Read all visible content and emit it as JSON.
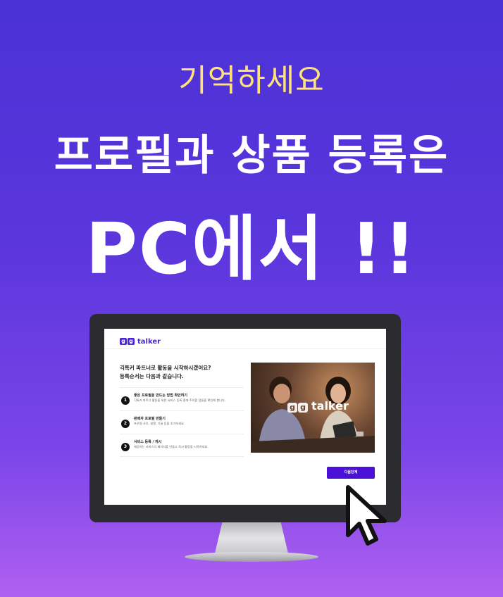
{
  "headline": {
    "kicker": "기억하세요",
    "sub": "프로필과 상품 등록은",
    "main": "PC에서 !!"
  },
  "colors": {
    "kicker": "#ffe27a",
    "accent": "#4a22d8",
    "button": "#4a10d8"
  },
  "screen": {
    "logo": {
      "mark": [
        "g",
        "g"
      ],
      "text": "talker"
    },
    "intro": [
      "긱톡커 파트너로 활동을 시작하시겠어요?",
      "등록순서는 다음과 같습니다."
    ],
    "steps": [
      {
        "num": "1",
        "title": "좋은 프로필을 만드는 방법 확인하기",
        "desc": "긱톡커 파트너 활동을 위한 서비스 등록 중에 주의할 점들을 확인해 봅니다."
      },
      {
        "num": "2",
        "title": "판매자 프로필 만들기",
        "desc": "프로필 사진, 설명, 기술 등을 추가하세요."
      },
      {
        "num": "3",
        "title": "서비스 등록 / 게시",
        "desc": "제공하는 서비스의 페이지를 만들고 즉시 활동을 시작하세요."
      }
    ],
    "photo_logo": {
      "mark": [
        "g",
        "g"
      ],
      "text": "talker"
    },
    "next_button": "다음단계"
  },
  "icons": {
    "cursor": "pointer-arrow-icon"
  }
}
